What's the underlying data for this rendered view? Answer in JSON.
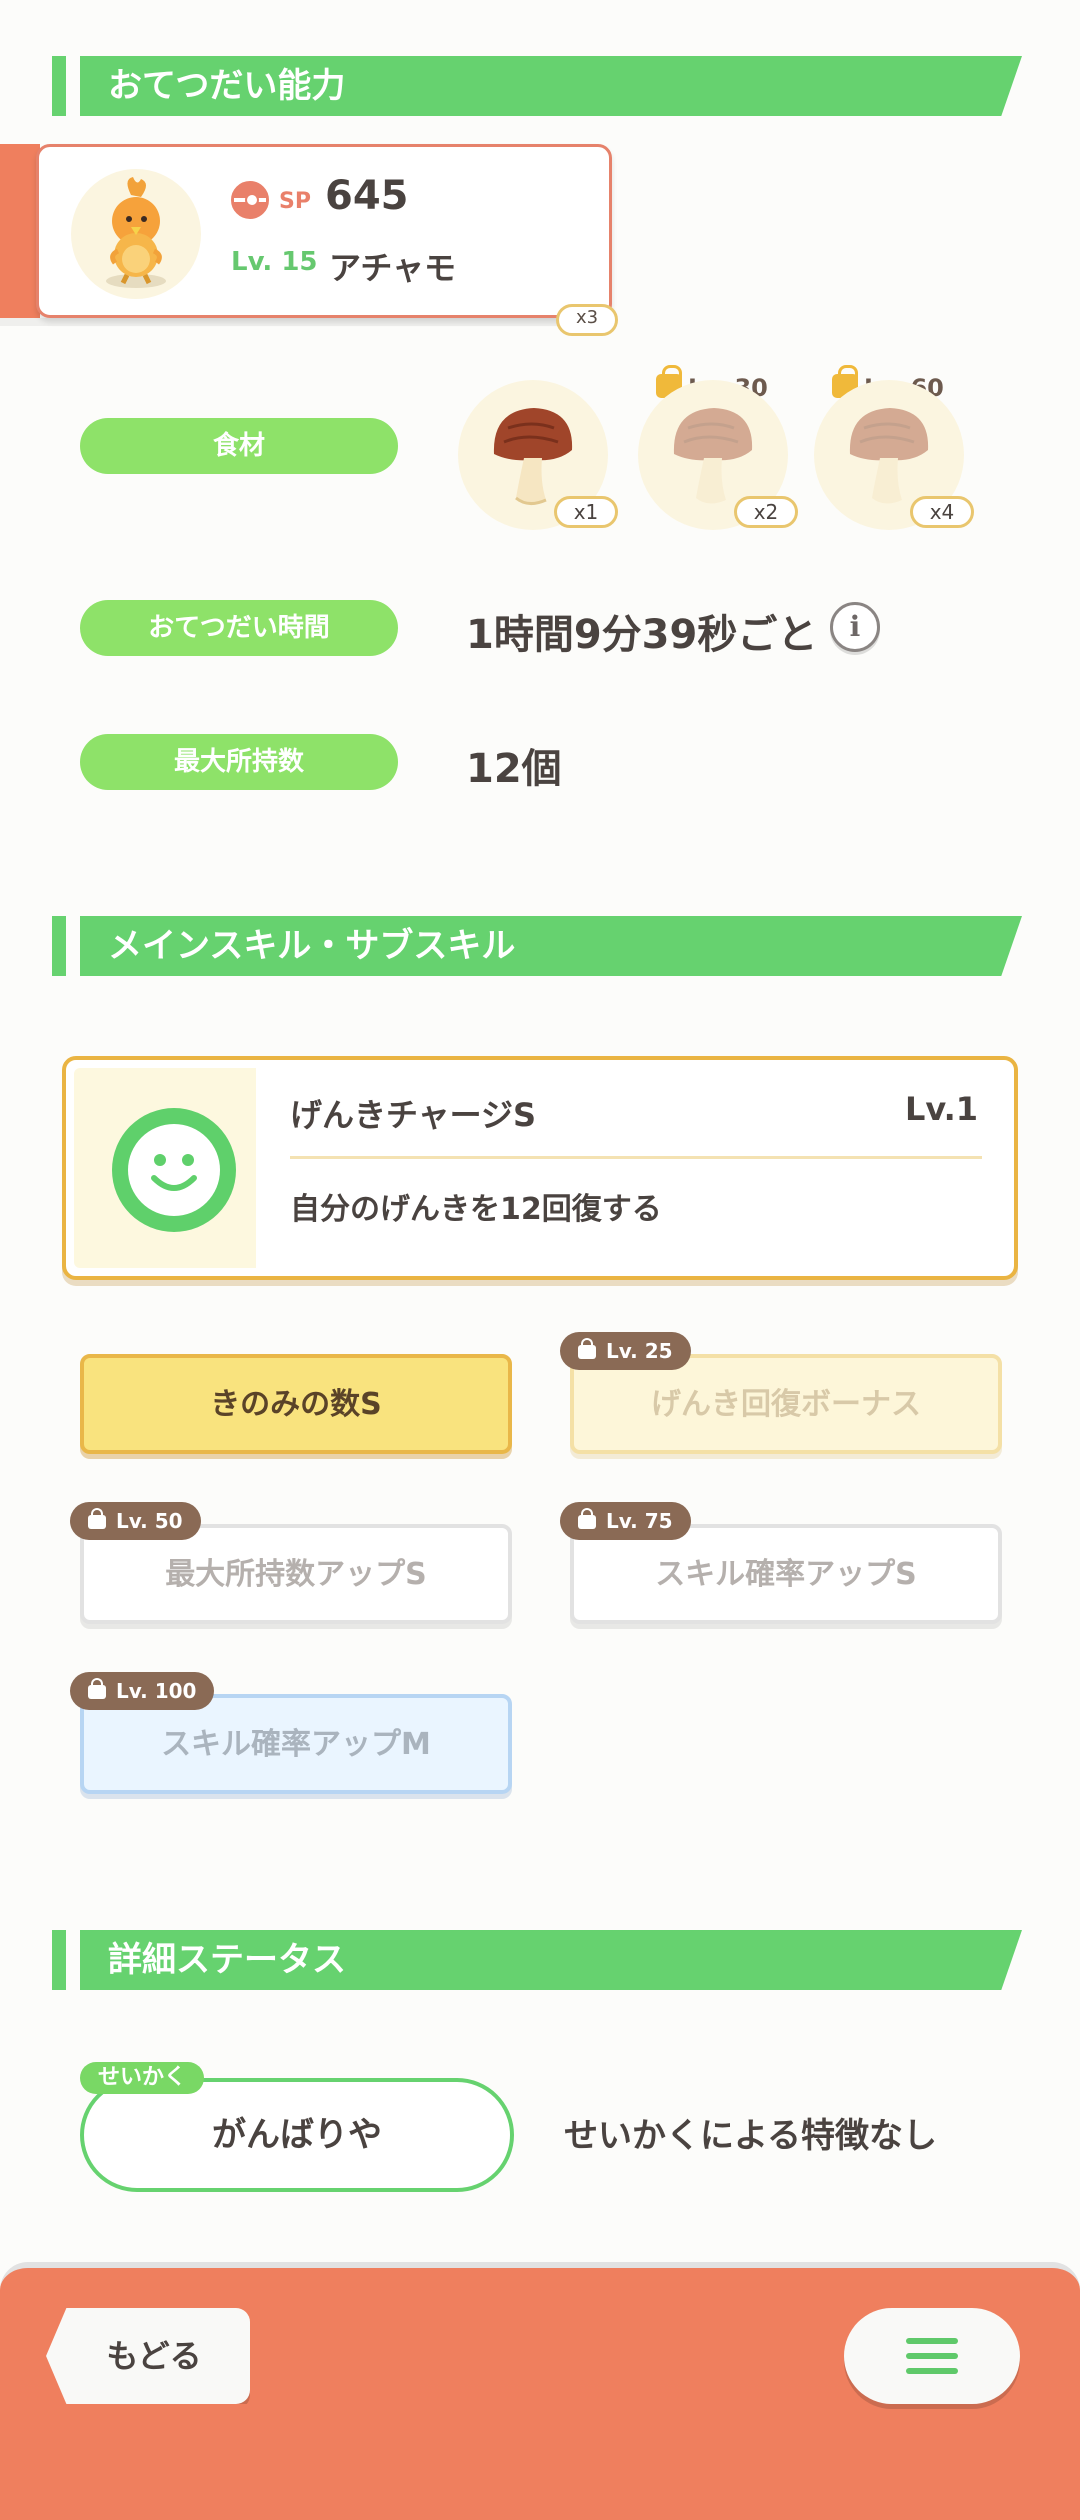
{
  "sections": {
    "help_ability": "おてつだい能力",
    "skills": "メインスキル・サブスキル",
    "details": "詳細ステータス"
  },
  "pokemon": {
    "sp_label": "SP",
    "sp_value": "645",
    "level": "Lv. 15",
    "name": "アチャモ",
    "peek_badge": "x3"
  },
  "ability": {
    "ingredients_label": "食材",
    "ingredients": [
      {
        "name": "mushroom",
        "count": "x1",
        "locked": false
      },
      {
        "name": "mushroom",
        "count": "x2",
        "locked": true,
        "unlock": "Lv. 30"
      },
      {
        "name": "mushroom",
        "count": "x4",
        "locked": true,
        "unlock": "Lv. 60"
      }
    ],
    "help_time_label": "おてつだい時間",
    "help_time_value": "1時間9分39秒ごと",
    "max_carry_label": "最大所持数",
    "max_carry_value": "12個",
    "info_icon": "i"
  },
  "main_skill": {
    "name": "げんきチャージS",
    "level": "Lv.1",
    "description": "自分のげんきを12回復する"
  },
  "sub_skills": [
    {
      "label": "きのみの数S",
      "locked": false
    },
    {
      "label": "げんき回復ボーナス",
      "locked": true,
      "unlock": "Lv. 25"
    },
    {
      "label": "最大所持数アップS",
      "locked": true,
      "unlock": "Lv. 50"
    },
    {
      "label": "スキル確率アップS",
      "locked": true,
      "unlock": "Lv. 75"
    },
    {
      "label": "スキル確率アップM",
      "locked": true,
      "unlock": "Lv. 100"
    }
  ],
  "nature": {
    "tag": "せいかく",
    "value": "がんばりや",
    "effect": "せいかくによる特徴なし"
  },
  "footer": {
    "back_label": "もどる"
  },
  "colors": {
    "accent_green": "#66d26f",
    "pill_green": "#8ee269",
    "footer_orange": "#ef7f5e",
    "gold": "#eab442"
  }
}
